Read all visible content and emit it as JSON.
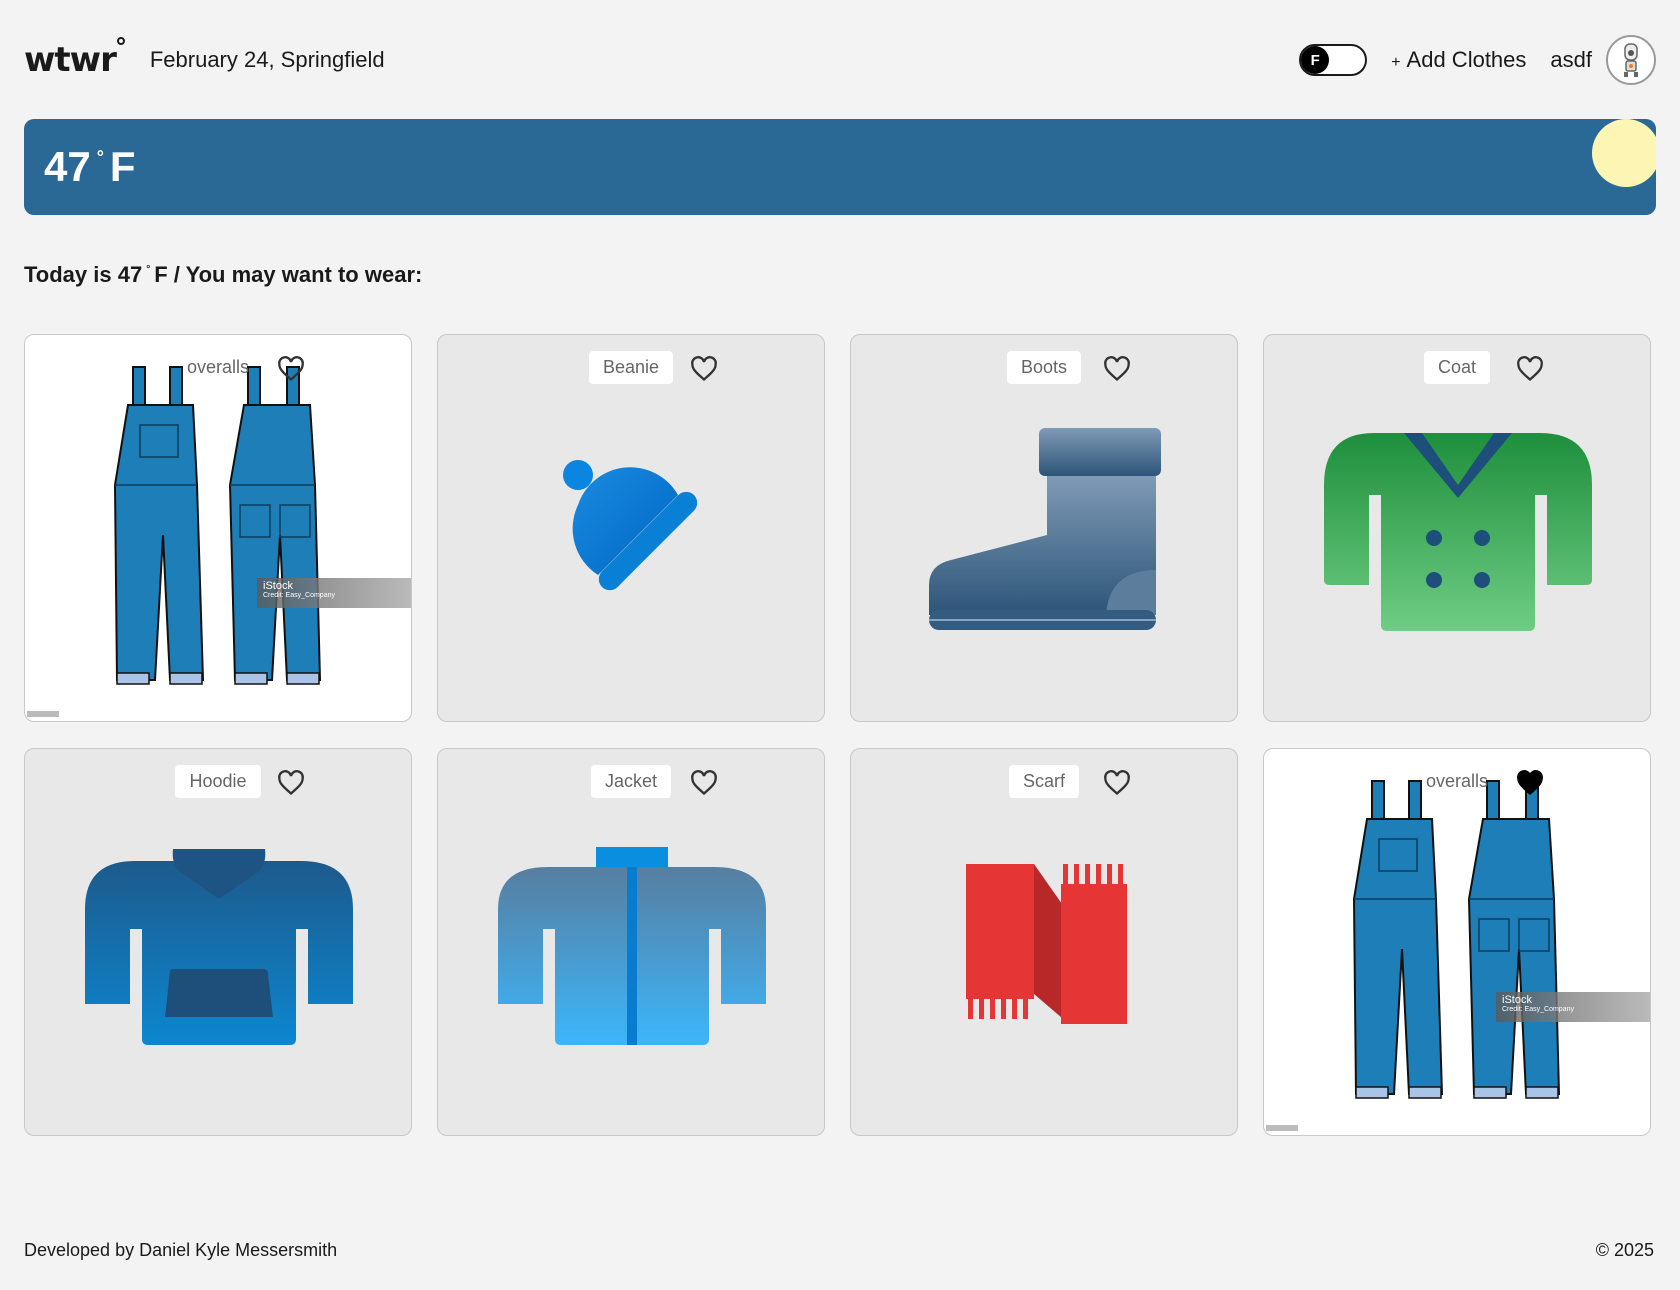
{
  "header": {
    "logo": "wtwr",
    "date_location": "February 24, Springfield",
    "toggle_label": "F",
    "add_clothes_plus": "+",
    "add_clothes_label": "Add Clothes",
    "username": "asdf"
  },
  "weather": {
    "temp_value": "47",
    "degree": "°",
    "unit": "F"
  },
  "recommendation": {
    "prefix": "Today is 47",
    "degree": "°",
    "suffix": "F / You may want to wear:"
  },
  "cards": [
    {
      "label": "overalls",
      "image": "overalls-image",
      "liked": false
    },
    {
      "label": "Beanie",
      "image": "beanie-icon",
      "liked": false
    },
    {
      "label": "Boots",
      "image": "boot-icon",
      "liked": false
    },
    {
      "label": "Coat",
      "image": "coat-icon",
      "liked": false
    },
    {
      "label": "Hoodie",
      "image": "hoodie-icon",
      "liked": false
    },
    {
      "label": "Jacket",
      "image": "jacket-icon",
      "liked": false
    },
    {
      "label": "Scarf",
      "image": "scarf-icon",
      "liked": false
    },
    {
      "label": "overalls",
      "image": "overalls-image",
      "liked": true
    }
  ],
  "watermark": {
    "brand": "iStock",
    "credit": "Credit: Easy_Company"
  },
  "footer": {
    "credit": "Developed by Daniel Kyle Messersmith",
    "copyright": "© 2025"
  },
  "colors": {
    "weather_banner": "#2a6895",
    "sun": "#fdf5b4",
    "background": "#f3f3f3"
  }
}
